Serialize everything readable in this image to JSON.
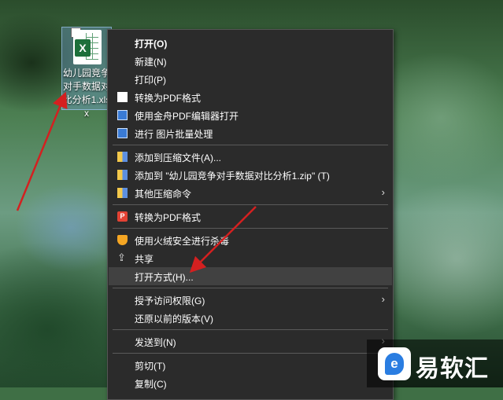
{
  "desktop": {
    "file": {
      "name": "幼儿园竞争对手数据对比分析1.xlsx",
      "icon": "excel-file-icon",
      "badge": "X",
      "checked": "✓"
    }
  },
  "context_menu": {
    "items": [
      {
        "label": "打开(O)",
        "bold": true,
        "icon": ""
      },
      {
        "label": "新建(N)",
        "icon": ""
      },
      {
        "label": "打印(P)",
        "icon": ""
      },
      {
        "label": "转换为PDF格式",
        "icon": "document-icon"
      },
      {
        "label": "使用金舟PDF编辑器打开",
        "icon": "pdf-editor-icon"
      },
      {
        "label": "进行 图片批量处理",
        "icon": "image-batch-icon"
      },
      {
        "label": "添加到压缩文件(A)...",
        "icon": "archive-icon"
      },
      {
        "label": "添加到 \"幼儿园竞争对手数据对比分析1.zip\" (T)",
        "icon": "archive-icon"
      },
      {
        "label": "其他压缩命令",
        "icon": "archive-icon",
        "submenu": "›"
      },
      {
        "label": "转换为PDF格式",
        "icon": "pdf-convert-icon",
        "icon_text": "P"
      },
      {
        "label": "使用火绒安全进行杀毒",
        "icon": "huorong-shield-icon"
      },
      {
        "label": "共享",
        "icon": "share-icon",
        "icon_text": "⇪"
      },
      {
        "label": "打开方式(H)...",
        "icon": "",
        "highlighted": true
      },
      {
        "label": "授予访问权限(G)",
        "icon": "",
        "submenu": "›"
      },
      {
        "label": "还原以前的版本(V)",
        "icon": ""
      },
      {
        "label": "发送到(N)",
        "icon": "",
        "submenu": "›"
      },
      {
        "label": "剪切(T)",
        "icon": ""
      },
      {
        "label": "复制(C)",
        "icon": ""
      }
    ]
  },
  "watermark": {
    "text": "易软汇",
    "logo_letter": "e"
  },
  "colors": {
    "menu_bg": "#2b2b2b",
    "highlight": "#414141",
    "annotation_arrow": "#d42020"
  }
}
